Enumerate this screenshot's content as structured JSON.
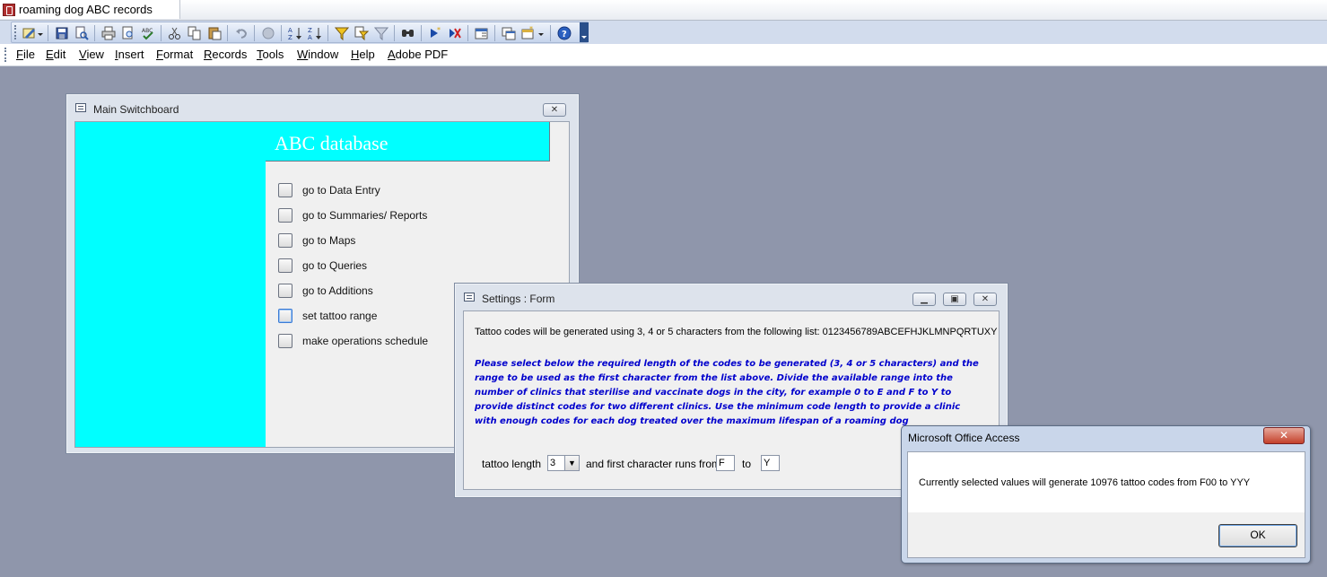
{
  "app": {
    "window_title": "roaming dog ABC records"
  },
  "menubar": {
    "items": [
      "File",
      "Edit",
      "View",
      "Insert",
      "Format",
      "Records",
      "Tools",
      "Window",
      "Help",
      "Adobe PDF"
    ]
  },
  "switchboard": {
    "title": "Main Switchboard",
    "heading": "ABC database",
    "items": [
      "go to Data Entry",
      "go to Summaries/ Reports",
      "go to Maps",
      "go to Queries",
      "go to Additions",
      "set tattoo range",
      "make operations schedule"
    ]
  },
  "settings": {
    "title": "Settings : Form",
    "intro": "Tattoo codes will be generated using 3, 4 or 5 characters from the following list: 0123456789ABCEFHJKLMNPQRTUXY",
    "instructions": "Please select below the required length of the codes to be generated (3, 4 or 5 characters) and the range to be used as the first character from the list above.  Divide the available range into the number of clinics that sterilise and vaccinate dogs in the city, for example 0 to E and F to Y to provide distinct codes for two different clinics. Use the minimum code length to provide a clinic with enough codes for each dog treated over the maximum lifespan of a roaming dog",
    "length_label": "tattoo length",
    "length_value": "3",
    "range_label": "and first character runs from",
    "range_from": "F",
    "to_label": "to",
    "range_to": "Y"
  },
  "msgbox": {
    "title": "Microsoft Office Access",
    "message": "Currently selected values will generate 10976 tattoo codes from F00 to YYY",
    "ok_label": "OK",
    "close_glyph": "✕"
  },
  "colors": {
    "desktop": "#8f96ab",
    "switchboard_accent": "#00ffff",
    "instruction_text": "#0000cc"
  },
  "icons": [
    "design-view-icon",
    "save-icon",
    "print-icon",
    "print-preview-icon",
    "spelling-icon",
    "cut-icon",
    "copy-icon",
    "paste-icon",
    "undo-icon",
    "sort-ascending-icon",
    "sort-descending-icon",
    "filter-icon",
    "find-icon",
    "new-record-icon",
    "delete-record-icon",
    "properties-icon",
    "database-window-icon",
    "new-object-icon",
    "help-icon"
  ]
}
